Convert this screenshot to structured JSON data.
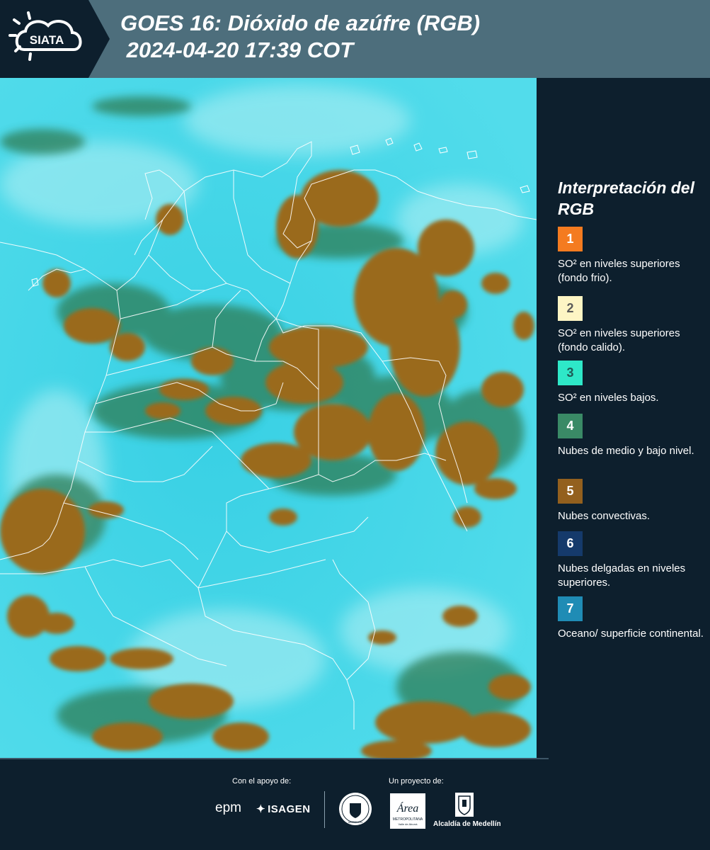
{
  "header": {
    "logo_text": "SIATA",
    "title": "GOES 16: Dióxido de azúfre (RGB)\n 2024-04-20 17:39 COT"
  },
  "map": {
    "background_color": "#3fd6e6",
    "cloud_color": "#9a6a1c",
    "border_color": "#ffffff"
  },
  "legend": {
    "title": "Interpretación del RGB",
    "items": [
      {
        "number": "1",
        "color": "#f47b20",
        "text_color": "#ffffff",
        "label": "SO² en niveles superiores (fondo frio)."
      },
      {
        "number": "2",
        "color": "#fdf5c4",
        "text_color": "#5a5a5a",
        "label": "SO² en niveles superiores (fondo calido)."
      },
      {
        "number": "3",
        "color": "#2ee8c8",
        "text_color": "#1f5a55",
        "label": "SO² en niveles bajos."
      },
      {
        "number": "4",
        "color": "#3a8a66",
        "text_color": "#ffffff",
        "label": "Nubes de medio y bajo nivel."
      },
      {
        "number": "5",
        "color": "#93601e",
        "text_color": "#ffffff",
        "label": "Nubes convectivas."
      },
      {
        "number": "6",
        "color": "#153a6b",
        "text_color": "#ffffff",
        "label": "Nubes delgadas en niveles superiores."
      },
      {
        "number": "7",
        "color": "#1f8cb5",
        "text_color": "#ffffff",
        "label": "Oceano/ superficie continental."
      }
    ]
  },
  "footer": {
    "support_label": "Con el apoyo de:",
    "project_label": "Un proyecto de:",
    "sponsors": [
      "epm",
      "ISAGEN"
    ],
    "seal_text": "MEDELLÍN",
    "area_text": "Área METROPOLITANA Valle de Aburrá",
    "alcaldia_text": "Alcaldía de Medellín"
  }
}
